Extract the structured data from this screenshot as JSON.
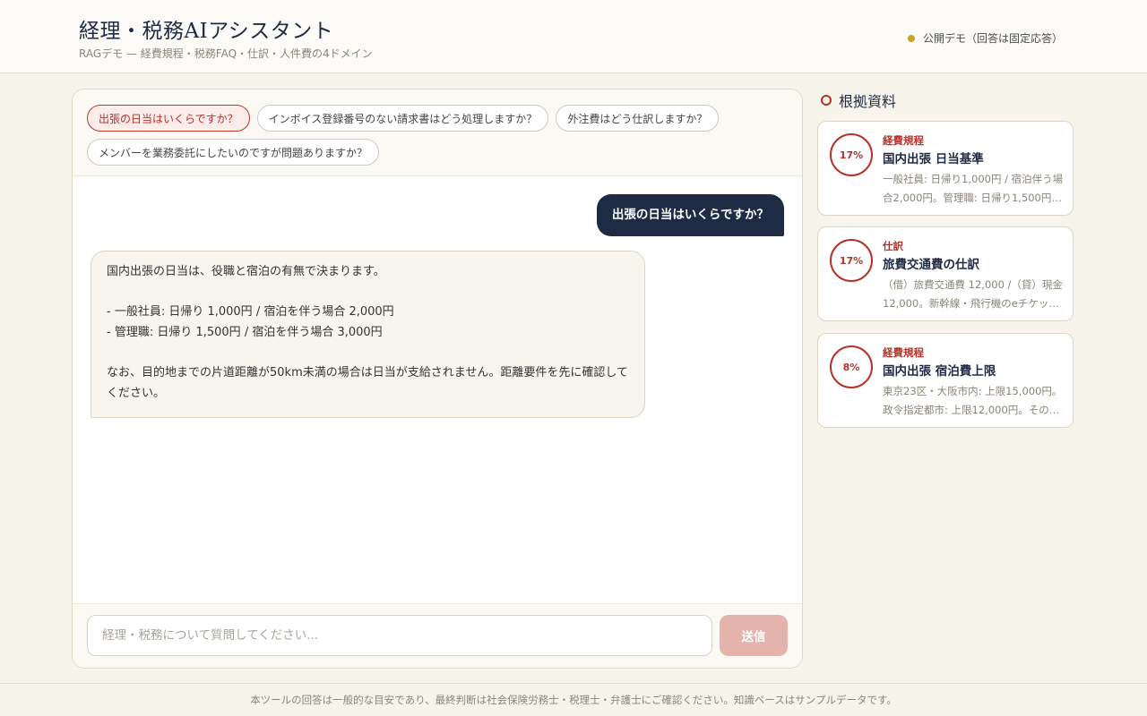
{
  "header": {
    "title": "経理・税務AIアシスタント",
    "subtitle": "RAGデモ — 経費規程・税務FAQ・仕訳・人件費の4ドメイン",
    "badge": "公開デモ（回答は固定応答）"
  },
  "suggestions": [
    {
      "label": "出張の日当はいくらですか？",
      "active": true
    },
    {
      "label": "インボイス登録番号のない請求書はどう処理しますか？",
      "active": false
    },
    {
      "label": "外注費はどう仕訳しますか？",
      "active": false
    },
    {
      "label": "メンバーを業務委託にしたいのですが問題ありますか？",
      "active": false
    }
  ],
  "conversation": {
    "user_message": "出張の日当はいくらですか？",
    "bot_message": {
      "line1": "国内出張の日当は、役職と宿泊の有無で決まります。",
      "line2": "- 一般社員: 日帰り 1,000円 / 宿泊を伴う場合 2,000円",
      "line3": "- 管理職: 日帰り 1,500円 / 宿泊を伴う場合 3,000円",
      "line4": "なお、目的地までの片道距離が50km未満の場合は日当が支給されません。距離要件を先に確認してください。"
    }
  },
  "input": {
    "placeholder": "経理・税務について質問してください...",
    "value": "",
    "send_label": "送信"
  },
  "sources": {
    "heading": "根拠資料",
    "items": [
      {
        "score": "17%",
        "category": "経費規程",
        "title": "国内出張 日当基準",
        "snippet": "一般社員: 日帰り1,000円 / 宿泊伴う場合2,000円。管理職: 日帰り1,500円…"
      },
      {
        "score": "17%",
        "category": "仕訳",
        "title": "旅費交通費の仕訳",
        "snippet": "（借）旅費交通費 12,000 /（貸）現金 12,000。新幹線・飛行機のeチケット…"
      },
      {
        "score": "8%",
        "category": "経費規程",
        "title": "国内出張 宿泊費上限",
        "snippet": "東京23区・大阪市内: 上限15,000円。政令指定都市: 上限12,000円。その他…"
      }
    ]
  },
  "footer": {
    "text": "本ツールの回答は一般的な目安であり、最終判断は社会保険労務士・税理士・弁護士にご確認ください。知識ベースはサンプルデータです。"
  },
  "colors": {
    "accent": "#b5332a",
    "navy": "#1f2a44",
    "status_dot": "#c9a227",
    "send_button": "#e3b3ac"
  }
}
